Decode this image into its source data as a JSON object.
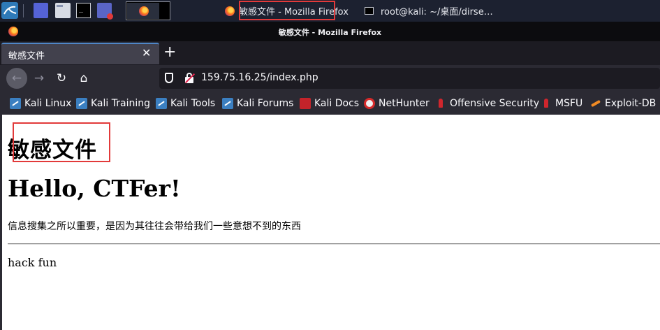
{
  "taskbar": {
    "firefox_window_title": "敏感文件 - Mozilla Firefox",
    "terminal_window_title": "root@kali: ~/桌面/dirse…",
    "terminal_glyph": "_",
    "highlight_color": "#e23a3a"
  },
  "browser": {
    "window_title": "敏感文件 - Mozilla Firefox",
    "tab": {
      "title": "敏感文件",
      "close_glyph": "✕"
    },
    "new_tab_glyph": "+",
    "nav": {
      "back_glyph": "←",
      "forward_glyph": "→",
      "reload_glyph": "↻",
      "home_glyph": "⌂"
    },
    "url": "159.75.16.25/index.php",
    "bookmarks": [
      {
        "label": "Kali Linux",
        "icon": "kali-dragon-icon"
      },
      {
        "label": "Kali Training",
        "icon": "kali-dragon-icon"
      },
      {
        "label": "Kali Tools",
        "icon": "kali-dragon-icon"
      },
      {
        "label": "Kali Forums",
        "icon": "kali-dragon-icon"
      },
      {
        "label": "Kali Docs",
        "icon": "kali-docs-icon"
      },
      {
        "label": "NetHunter",
        "icon": "nethunter-icon"
      },
      {
        "label": "Offensive Security",
        "icon": "offsec-icon"
      },
      {
        "label": "MSFU",
        "icon": "offsec-icon"
      },
      {
        "label": "Exploit-DB",
        "icon": "exploit-db-icon"
      }
    ]
  },
  "page": {
    "heading_cn": "敏感文件",
    "heading_en": "Hello, CTFer!",
    "info": "信息搜集之所以重要，是因为其往往会带给我们一些意想不到的东西",
    "footer": "hack fun"
  }
}
